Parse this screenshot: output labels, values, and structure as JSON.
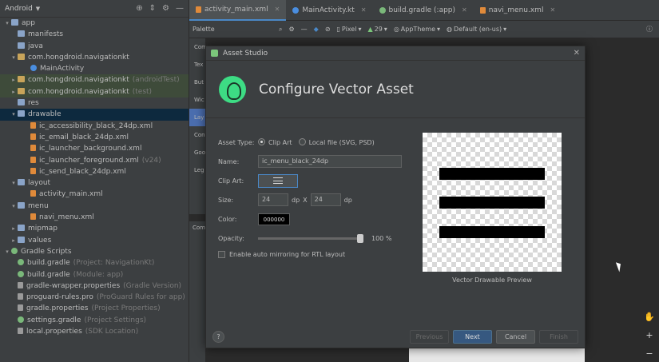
{
  "project": {
    "view": "Android",
    "items": [
      {
        "label": "app",
        "icon": "folder-icon",
        "indent": 0,
        "arrow": "▾"
      },
      {
        "label": "manifests",
        "icon": "folder-icon",
        "indent": 1,
        "arrow": ""
      },
      {
        "label": "java",
        "icon": "folder-icon",
        "indent": 1,
        "arrow": ""
      },
      {
        "label": "com.hongdroid.navigationkt",
        "icon": "package-icon",
        "indent": 1,
        "arrow": "▾"
      },
      {
        "label": "MainActivity",
        "icon": "kotlin-class-icon",
        "indent": 3,
        "arrow": ""
      },
      {
        "label": "com.hongdroid.navigationkt",
        "suffix": "(androidTest)",
        "icon": "package-icon",
        "indent": 1,
        "arrow": "▸",
        "style": "hl-green"
      },
      {
        "label": "com.hongdroid.navigationkt",
        "suffix": "(test)",
        "icon": "package-icon",
        "indent": 1,
        "arrow": "▸",
        "style": "hl-green"
      },
      {
        "label": "res",
        "icon": "folder-icon",
        "indent": 1,
        "arrow": ""
      },
      {
        "label": "drawable",
        "icon": "folder-icon",
        "indent": 1,
        "arrow": "▾",
        "style": "selected"
      },
      {
        "label": "ic_accessibility_black_24dp.xml",
        "icon": "xml-file-icon",
        "indent": 3,
        "arrow": ""
      },
      {
        "label": "ic_email_black_24dp.xml",
        "icon": "xml-file-icon",
        "indent": 3,
        "arrow": ""
      },
      {
        "label": "ic_launcher_background.xml",
        "icon": "xml-file-icon",
        "indent": 3,
        "arrow": ""
      },
      {
        "label": "ic_launcher_foreground.xml",
        "suffix": "(v24)",
        "icon": "xml-file-icon",
        "indent": 3,
        "arrow": ""
      },
      {
        "label": "ic_send_black_24dp.xml",
        "icon": "xml-file-icon",
        "indent": 3,
        "arrow": ""
      },
      {
        "label": "layout",
        "icon": "folder-icon",
        "indent": 1,
        "arrow": "▾"
      },
      {
        "label": "activity_main.xml",
        "icon": "xml-file-icon",
        "indent": 3,
        "arrow": ""
      },
      {
        "label": "menu",
        "icon": "folder-icon",
        "indent": 1,
        "arrow": "▾"
      },
      {
        "label": "navi_menu.xml",
        "icon": "xml-file-icon",
        "indent": 3,
        "arrow": ""
      },
      {
        "label": "mipmap",
        "icon": "folder-icon",
        "indent": 1,
        "arrow": "▸"
      },
      {
        "label": "values",
        "icon": "folder-icon",
        "indent": 1,
        "arrow": "▸"
      },
      {
        "label": "Gradle Scripts",
        "icon": "gradle-icon",
        "indent": 0,
        "arrow": "▾"
      },
      {
        "label": "build.gradle",
        "suffix": "(Project: NavigationKt)",
        "icon": "gradle-file-icon",
        "indent": 1,
        "arrow": ""
      },
      {
        "label": "build.gradle",
        "suffix": "(Module: app)",
        "icon": "gradle-file-icon",
        "indent": 1,
        "arrow": ""
      },
      {
        "label": "gradle-wrapper.properties",
        "suffix": "(Gradle Version)",
        "icon": "properties-file-icon",
        "indent": 1,
        "arrow": ""
      },
      {
        "label": "proguard-rules.pro",
        "suffix": "(ProGuard Rules for app)",
        "icon": "properties-file-icon",
        "indent": 1,
        "arrow": ""
      },
      {
        "label": "gradle.properties",
        "suffix": "(Project Properties)",
        "icon": "properties-file-icon",
        "indent": 1,
        "arrow": ""
      },
      {
        "label": "settings.gradle",
        "suffix": "(Project Settings)",
        "icon": "gradle-file-icon",
        "indent": 1,
        "arrow": ""
      },
      {
        "label": "local.properties",
        "suffix": "(SDK Location)",
        "icon": "properties-file-icon",
        "indent": 1,
        "arrow": ""
      }
    ]
  },
  "tabs": [
    {
      "label": "activity_main.xml",
      "icon": "xml-file-icon",
      "active": true
    },
    {
      "label": "MainActivity.kt",
      "icon": "kotlin-class-icon",
      "active": false
    },
    {
      "label": "build.gradle (:app)",
      "icon": "gradle-file-icon",
      "active": false
    },
    {
      "label": "navi_menu.xml",
      "icon": "xml-file-icon",
      "active": false
    }
  ],
  "toolbar": {
    "palette": "Palette",
    "device": "Pixel",
    "api": "29",
    "theme": "AppTheme",
    "locale": "Default (en-us)"
  },
  "palette_items": [
    "Com",
    "Tex",
    "But",
    "Wic",
    "Lay",
    "Con",
    "Goo",
    "Leg"
  ],
  "component_tree": "Com",
  "dialog": {
    "window_title": "Asset Studio",
    "heading": "Configure Vector Asset",
    "asset_type_label": "Asset Type:",
    "asset_type_options": [
      "Clip Art",
      "Local file (SVG, PSD)"
    ],
    "asset_type_selected": "Clip Art",
    "name_label": "Name:",
    "name_value": "ic_menu_black_24dp",
    "clip_art_label": "Clip Art:",
    "clip_art_icon": "menu-icon",
    "size_label": "Size:",
    "size_width": "24",
    "size_unit1": "dp",
    "size_x": "X",
    "size_height": "24",
    "size_unit2": "dp",
    "color_label": "Color:",
    "color_value": "000000",
    "opacity_label": "Opacity:",
    "opacity_value": "100 %",
    "opacity_fraction": 1.0,
    "mirroring_label": "Enable auto mirroring for RTL layout",
    "preview_caption": "Vector Drawable Preview",
    "buttons": {
      "help": "?",
      "previous": "Previous",
      "next": "Next",
      "cancel": "Cancel",
      "finish": "Finish"
    }
  },
  "colors": {
    "accent": "#4a88c7",
    "primary_button": "#365880",
    "android_green": "#3ddc84"
  }
}
